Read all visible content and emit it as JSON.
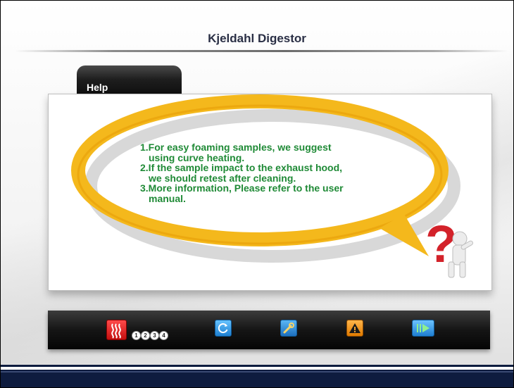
{
  "header": {
    "title": "Kjeldahl Digestor"
  },
  "help": {
    "tab_label": "Help",
    "lines": [
      {
        "text": "1.For easy foaming samples, we suggest"
      },
      {
        "text": "using curve heating."
      },
      {
        "text": "2.If the sample impact to the exhaust hood,"
      },
      {
        "text": "we should retest after cleaning."
      },
      {
        "text": "3.More information, Please refer to the user"
      },
      {
        "text": "manual."
      }
    ]
  },
  "toolbar": {
    "heating_icon": "heating-element-icon",
    "steps": [
      "1",
      "2",
      "3",
      "4"
    ],
    "buttons": [
      {
        "name": "refresh",
        "icon": "refresh-icon"
      },
      {
        "name": "tools",
        "icon": "wrench-icon"
      },
      {
        "name": "warning",
        "icon": "warning-icon"
      },
      {
        "name": "play",
        "icon": "play-icon"
      }
    ]
  },
  "colors": {
    "help_text": "#1f8a36",
    "bubble": "#f4b81c",
    "bottom_band": "#0e1c3f"
  }
}
